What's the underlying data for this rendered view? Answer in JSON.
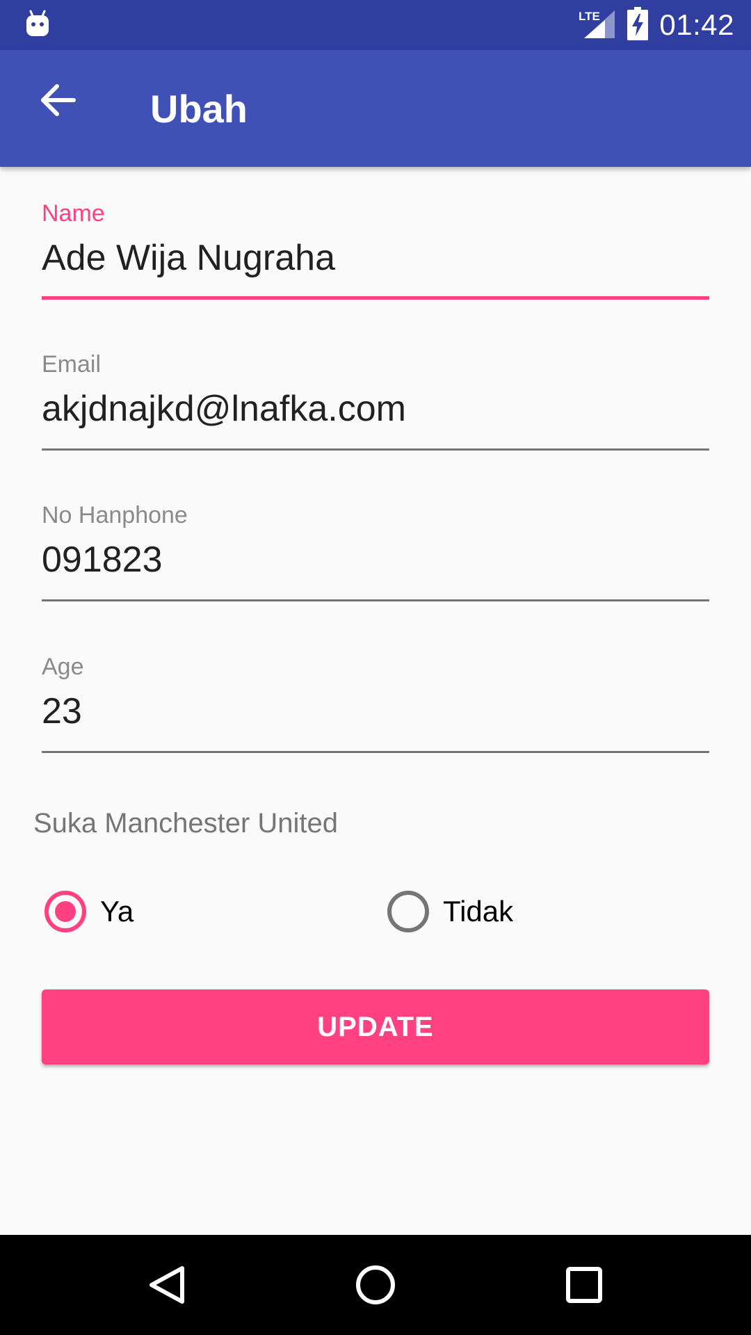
{
  "status_bar": {
    "time": "01:42",
    "network": "LTE",
    "icons": [
      "android-debug-icon",
      "lte-signal-icon",
      "battery-charging-icon"
    ]
  },
  "app_bar": {
    "title": "Ubah",
    "back_icon": "arrow-back-icon"
  },
  "form": {
    "name": {
      "label": "Name",
      "value": "Ade Wija Nugraha",
      "focused": true
    },
    "email": {
      "label": "Email",
      "value": "akjdnajkd@lnafka.com"
    },
    "phone": {
      "label": "No Hanphone",
      "value": "091823"
    },
    "age": {
      "label": "Age",
      "value": "23"
    }
  },
  "preference": {
    "question": "Suka Manchester United",
    "options": [
      {
        "label": "Ya",
        "checked": true
      },
      {
        "label": "Tidak",
        "checked": false
      }
    ]
  },
  "update_button": {
    "label": "UPDATE"
  },
  "colors": {
    "primary": "#3F51B5",
    "primary_dark": "#303F9F",
    "accent": "#FF4081",
    "background": "#FAFAFA"
  },
  "nav_bar": {
    "icons": [
      "nav-back-icon",
      "nav-home-icon",
      "nav-recents-icon"
    ]
  }
}
